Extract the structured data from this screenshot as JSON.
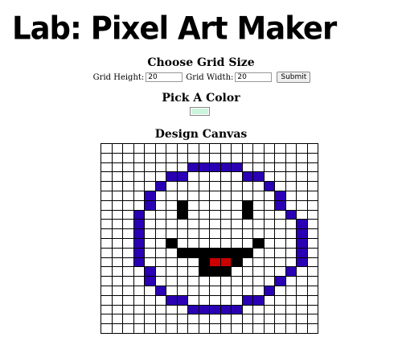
{
  "header": {
    "title": "Lab: Pixel Art Maker"
  },
  "grid_size": {
    "heading": "Choose Grid Size",
    "height_label": "Grid Height:",
    "height_value": "20",
    "width_label": "Grid Width:",
    "width_value": "20",
    "submit_label": "Submit"
  },
  "color": {
    "heading": "Pick A Color",
    "value": "#ccf5dd"
  },
  "canvas": {
    "heading": "Design Canvas",
    "rows": 20,
    "cols": 20,
    "colors": {
      "b": "#2b00b5",
      "k": "#000000",
      "r": "#cc0000"
    },
    "pixels": [
      "....................",
      "....................",
      "........bbbbb.......",
      "......bb.....bb.....",
      ".....b.........b....",
      "....b...........b...",
      "....b..k.....k..b...",
      "...b...k.....k...b..",
      "...b..............b.",
      "...b..............b.",
      "...b..k.......k...b.",
      "...b...kkkkkkk....b.",
      "...b.....krrk.....b.",
      "....b....kkk.....b..",
      "....b...........b...",
      ".....b.........b....",
      "......bb.....bb.....",
      "........bbbbb.......",
      "....................",
      "...................."
    ]
  }
}
